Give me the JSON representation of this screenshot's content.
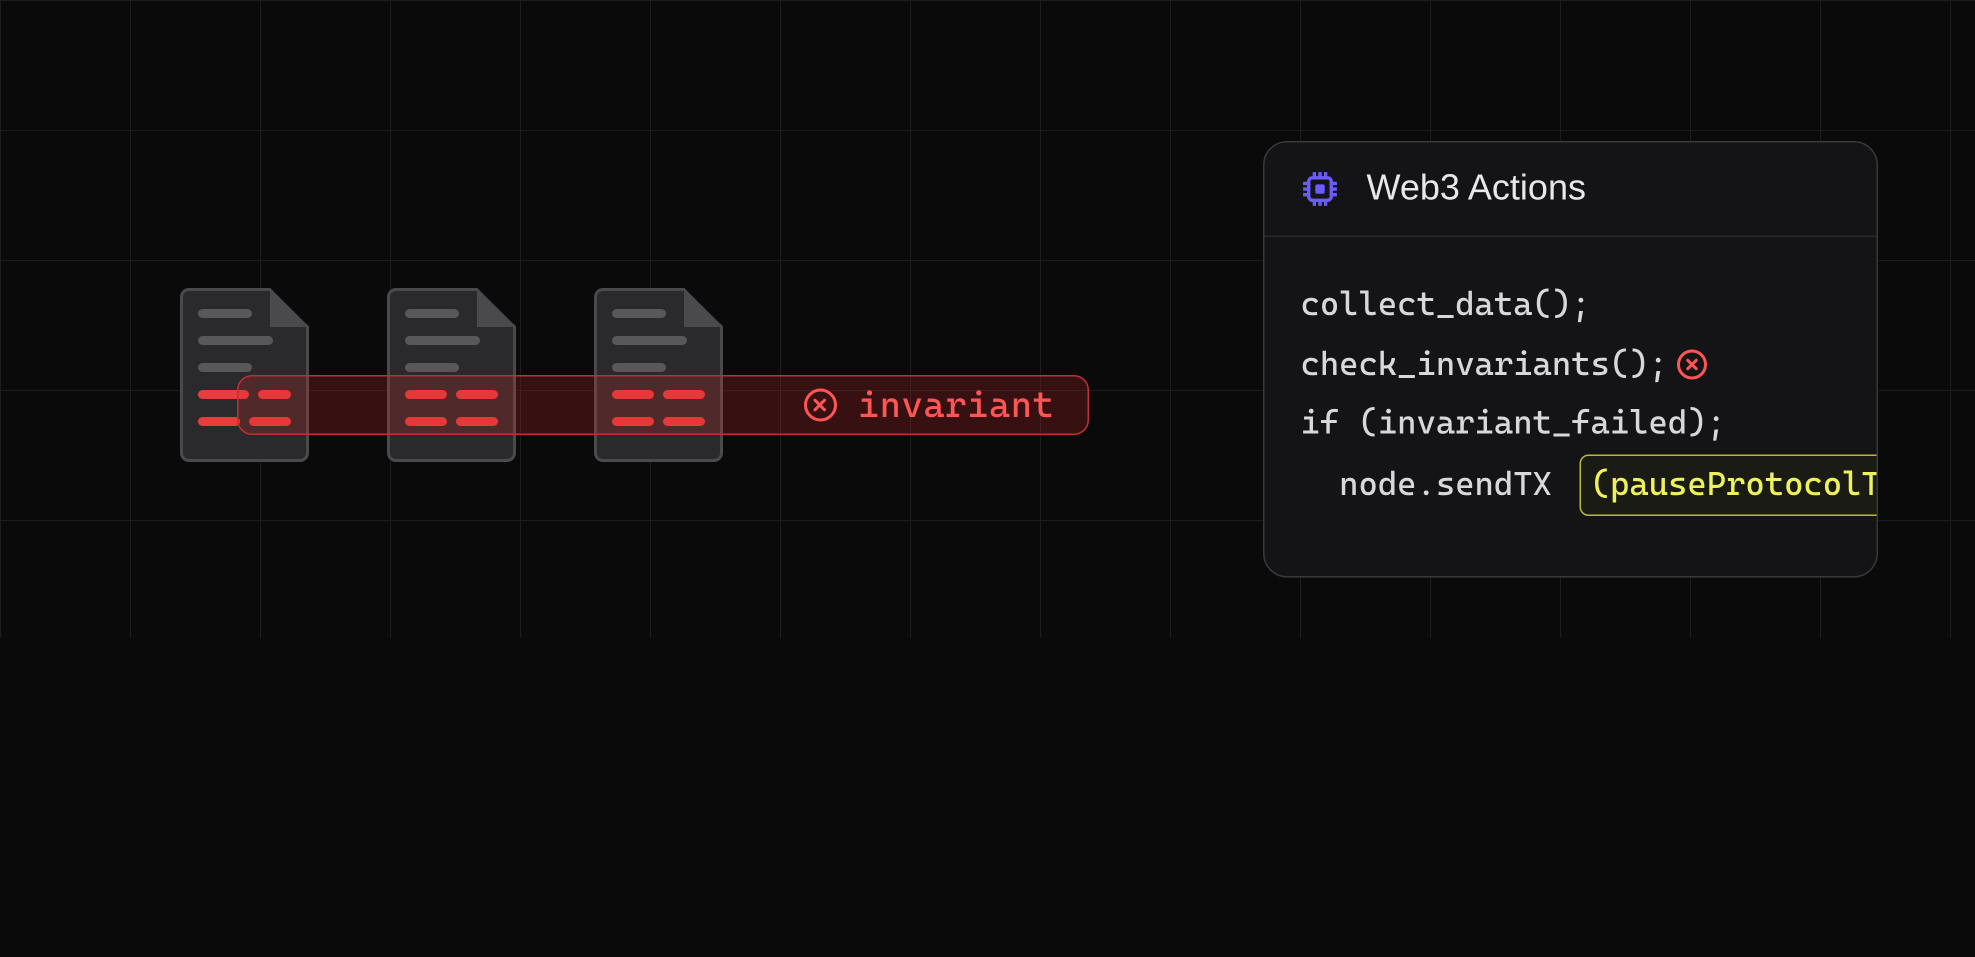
{
  "left": {
    "invariant_label": "invariant"
  },
  "panel": {
    "title": "Web3 Actions",
    "code": {
      "line1": "collect_data();",
      "line2": "check_invariants();",
      "line3": "if (invariant_failed);",
      "line4a": "  node.sendTX ",
      "line4b": "(pauseProtocolTx)",
      "line4c": ";"
    }
  },
  "colors": {
    "accent_purple": "#6b5cff",
    "error_red": "#ff5555",
    "highlight_yellow": "#eef25a"
  }
}
